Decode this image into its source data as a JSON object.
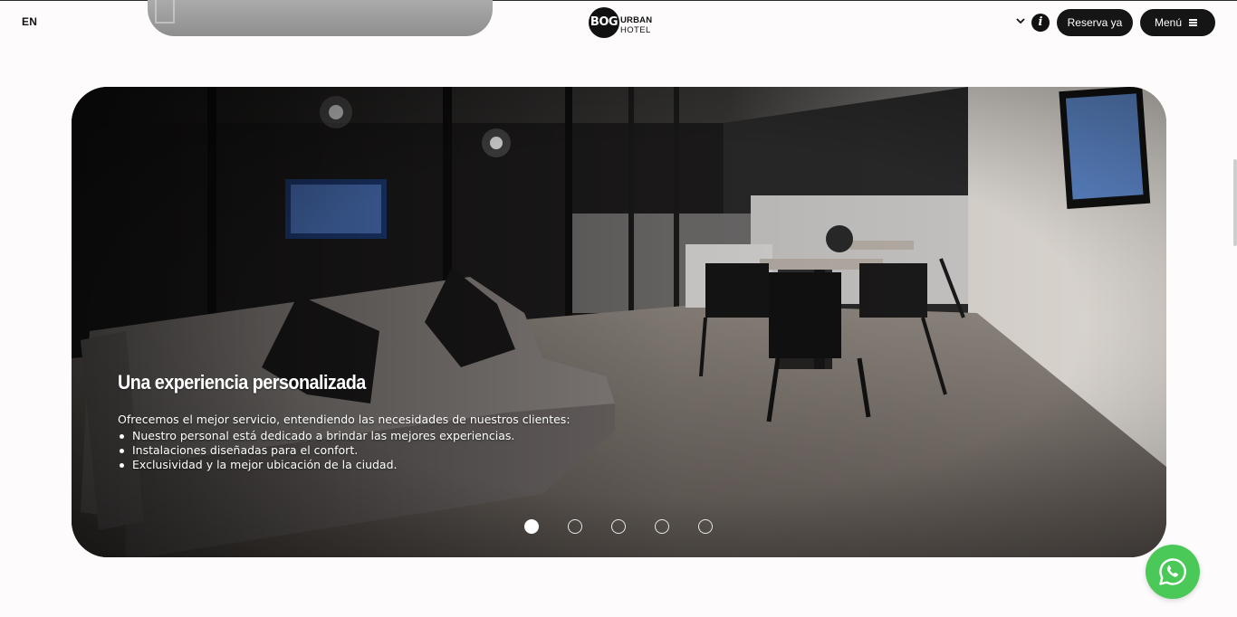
{
  "header": {
    "language_label": "EN",
    "logo": {
      "mark": "BOG",
      "word_top": "URBAN",
      "word_bottom": "HOTEL"
    },
    "reserve_label": "Reserva ya",
    "menu_label": "Menú",
    "info_glyph": "i",
    "icons": [
      "chevron-down-icon",
      "info-icon",
      "hamburger-icon"
    ]
  },
  "slider": {
    "slide_count": 5,
    "active_index": 0,
    "heading": "Una experiencia personalizada",
    "intro": "Ofrecemos el mejor servicio, entendiendo las necesidades de nuestros clientes:",
    "bullets": [
      "Nuestro personal está dedicado a brindar las mejores experiencias.",
      "Instalaciones diseñadas para el confort.",
      "Exclusividad y la mejor ubicación de la ciudad."
    ]
  },
  "floating": {
    "whatsapp_icon": "whatsapp-icon",
    "color": "#4ac959"
  },
  "colors": {
    "background": "#fdfbfc",
    "button_bg": "#151515",
    "button_text": "#ffffff"
  }
}
